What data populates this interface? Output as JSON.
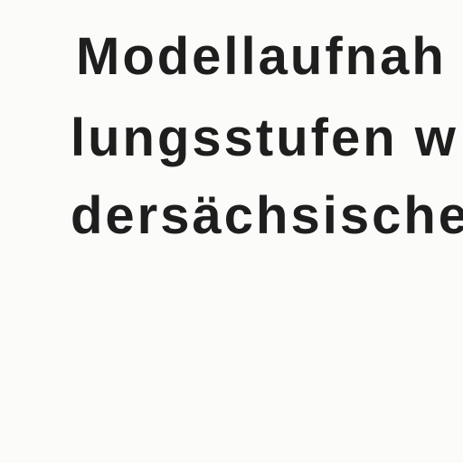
{
  "document": {
    "lines": [
      "Modellaufnah",
      "lungsstufen w",
      "dersächsische"
    ]
  }
}
